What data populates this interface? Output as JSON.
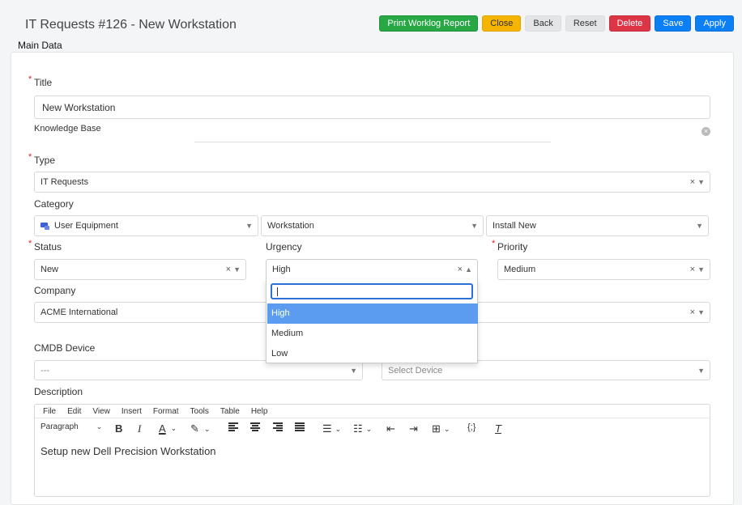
{
  "header": {
    "title": "IT Requests #126 - New Workstation",
    "buttons": {
      "print": "Print Worklog Report",
      "close": "Close",
      "back": "Back",
      "reset": "Reset",
      "delete": "Delete",
      "save": "Save",
      "apply": "Apply"
    },
    "colors": {
      "print": "#28a745",
      "close": "#f5b400",
      "delete": "#dc3545",
      "save": "#0d7ff5"
    }
  },
  "main": {
    "section_label": "Main Data",
    "title": {
      "label": "Title",
      "value": "New Workstation"
    },
    "knowledge_base": {
      "label": "Knowledge Base"
    },
    "type": {
      "label": "Type",
      "value": "IT Requests"
    },
    "category": {
      "label": "Category",
      "level1": "User Equipment",
      "level1_icon": "equipment-icon",
      "level2": "Workstation",
      "level3": "Install New"
    },
    "status": {
      "label": "Status",
      "value": "New"
    },
    "urgency": {
      "label": "Urgency",
      "value": "High",
      "search_value": "",
      "options": [
        "High",
        "Medium",
        "Low"
      ],
      "highlighted": "High"
    },
    "priority": {
      "label": "Priority",
      "value": "Medium"
    },
    "company": {
      "label": "Company",
      "value": "ACME International"
    },
    "cmdb": {
      "label": "CMDB Device",
      "left_value": "---",
      "device_placeholder": "Select Device"
    },
    "description": {
      "label": "Description",
      "menu": [
        "File",
        "Edit",
        "View",
        "Insert",
        "Format",
        "Tools",
        "Table",
        "Help"
      ],
      "paragraph_label": "Paragraph",
      "content": "Setup new Dell Precision Workstation"
    }
  }
}
